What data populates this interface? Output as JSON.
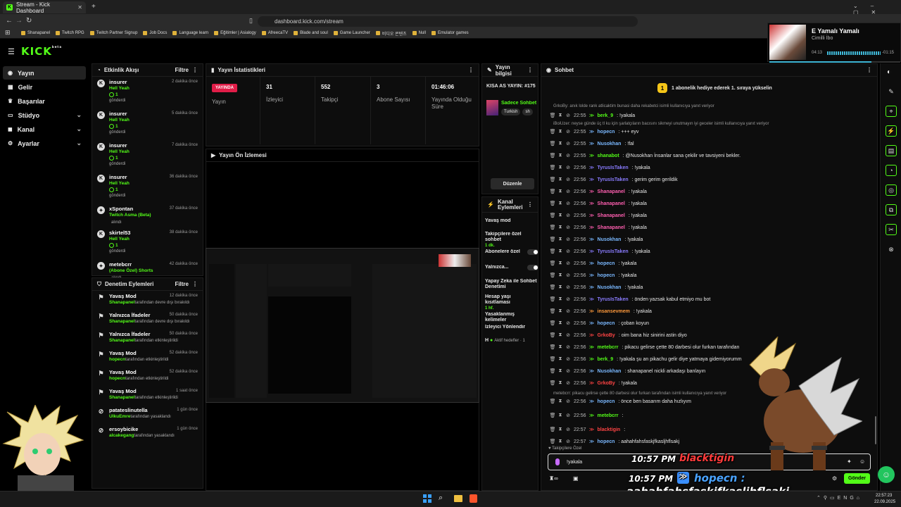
{
  "browser": {
    "tab_title": "Stream - Kick Dashboard",
    "url": "dashboard.kick.com/stream",
    "bookmarks": [
      "Shanapanel",
      "Twitch RPG",
      "Twitch Partner Signup",
      "Job Docs",
      "Language learn",
      "Eğitimler | Asialogy",
      "AfreecaTV",
      "Blade and soul",
      "Game Launcher",
      "비디오 콘텐츠",
      "Null",
      "Emulator games"
    ]
  },
  "music": {
    "title": "E Yamalı Yamalı",
    "artist": "Cimilli İbo",
    "elapsed": "04:13",
    "remaining": "-01:15"
  },
  "app": {
    "logo": "KICK",
    "logo_sup": "beta"
  },
  "nav": [
    {
      "label": "Yayın",
      "icon": "broadcast-icon",
      "active": true
    },
    {
      "label": "Gelir",
      "icon": "revenue-icon"
    },
    {
      "label": "Başarılar",
      "icon": "trophy-icon"
    },
    {
      "label": "Stüdyo",
      "icon": "studio-icon",
      "chev": true
    },
    {
      "label": "Kanal",
      "icon": "channel-icon",
      "chev": true
    },
    {
      "label": "Ayarlar",
      "icon": "settings-icon",
      "chev": true
    }
  ],
  "activity": {
    "title": "Etkinlik Akışı",
    "filter": "Filtre",
    "items": [
      {
        "name": "insurer",
        "sub": "Hell Yeah",
        "count": "1",
        "sent": "gönderdi",
        "time": "2 dakika önce"
      },
      {
        "name": "insurer",
        "sub": "Hell Yeah",
        "count": "1",
        "sent": "gönderdi",
        "time": "5 dakika önce"
      },
      {
        "name": "insurer",
        "sub": "Hell Yeah",
        "count": "1",
        "sent": "gönderdi",
        "time": "7 dakika önce"
      },
      {
        "name": "insurer",
        "sub": "Hell Yeah",
        "count": "1",
        "sent": "gönderdi",
        "time": "36 dakika önce"
      },
      {
        "name": "xSpontan",
        "sub": "Twitch Asma (Beta)",
        "sent": "alındı",
        "time": "37 dakika önce"
      },
      {
        "name": "skirtel53",
        "sub": "Hell Yeah",
        "count": "1",
        "sent": "gönderdi",
        "time": "38 dakika önce"
      },
      {
        "name": "metebcrr",
        "sub": "(Abone Özel) Shorts",
        "sent": "alındı",
        "time": "42 dakika önce"
      }
    ]
  },
  "moderation": {
    "title": "Denetim Eylemleri",
    "filter": "Filtre",
    "items": [
      {
        "name": "Yavaş Mod",
        "by": "Shanapanel",
        "rest": "tarafından devre dışı bırakıldı",
        "time": "12 dakika önce"
      },
      {
        "name": "Yalnızca İfadeler",
        "by": "Shanapanel",
        "rest": "tarafından devre dışı bırakıldı",
        "time": "50 dakika önce"
      },
      {
        "name": "Yalnızca İfadeler",
        "by": "Shanapanel",
        "rest": "tarafından etkinleştirildi",
        "time": "50 dakika önce"
      },
      {
        "name": "Yavaş Mod",
        "by": "hopecn",
        "rest": "tarafından etkinleştirildi",
        "time": "52 dakika önce"
      },
      {
        "name": "Yavaş Mod",
        "by": "hopecn",
        "rest": "tarafından etkinleştirildi",
        "time": "52 dakika önce"
      },
      {
        "name": "Yavaş Mod",
        "by": "Shanapanel",
        "rest": "tarafından etkinleştirildi",
        "time": "1 saat önce"
      },
      {
        "name": "patateslinutella",
        "by": "UlkuEmre",
        "rest": "tarafından yasaklandı",
        "time": "1 gün önce"
      },
      {
        "name": "ersoybicike",
        "by": "alcakegang",
        "rest": "tarafından yasaklandı",
        "time": "1 gün önce"
      }
    ]
  },
  "stats": {
    "title": "Yayın İstatistikleri",
    "live": "YAYINDA",
    "live_label": "Yayın",
    "viewers": "31",
    "viewers_label": "İzleyici",
    "followers": "552",
    "followers_label": "Takipçi",
    "subs": "3",
    "subs_label": "Abone Sayısı",
    "uptime": "01:46:06",
    "uptime_label": "Yayında Olduğu Süre"
  },
  "preview": {
    "title": "Yayın Ön İzlemesi"
  },
  "info": {
    "title": "Yayın bilgisi",
    "stream_title": "KISA AS YAYIN: #175",
    "category": "Sadece Sohbet",
    "tags": [
      "Turkish",
      "sh"
    ],
    "edit": "Düzenle"
  },
  "actions": {
    "title": "Kanal Eylemleri",
    "items": [
      "Yavaş mod",
      "Takipçilere özel sohbet",
      "Abonelere özel",
      "Yalnızca...",
      "Yapay Zeka ile Sohbet Denetimi",
      "Hesap yaşı kısıtlaması",
      "Yasaklanmış kelimeler",
      "İzleyici Yönlendir",
      "Aktif hedefler · 1"
    ],
    "follow_sub": "1 dk.",
    "age_sub": "1 hf.",
    "goal_prefix": "H"
  },
  "chat": {
    "title": "Sohbet",
    "gift_banner": "1 abonelik hediye ederek 1. sıraya yükselin",
    "replies": [
      {
        "text": "GrkoBy: anık lolde rank atlicaktim bunasi daha rekabetci isimli kullanıcıya yanıt veriyor"
      },
      {
        "text": "iBoiUzer: neyse günde üç tl ku için şarlatçıların bacısını sikmeyi unutmayın iyi geceler isimli kullanıcıya yanıt veriyor"
      },
      {
        "text": "metebcrr: pikacu gelirse çette 80 darbesi olur furkan tarafından isimli kullanıcıya yanıt veriyor"
      }
    ],
    "messages": [
      {
        "t": "22:55",
        "u": "berk_9",
        "c": "#53fc18",
        "m": ": !yakala"
      },
      {
        "t": "22:55",
        "u": "hopecn",
        "c": "#7ab8ff",
        "m": ": +++ eyv"
      },
      {
        "t": "22:55",
        "u": "Nusokhan",
        "c": "#7ab8ff",
        "m": ": !fal"
      },
      {
        "t": "22:55",
        "u": "shanabot",
        "c": "#53fc18",
        "m": ": @Nusokhan İnsanlar sana çekilir ve tavsiyeni bekler."
      },
      {
        "t": "22:56",
        "u": "TyrusIsTaken",
        "c": "#8a7cff",
        "m": ": !yakala"
      },
      {
        "t": "22:56",
        "u": "TyrusIsTaken",
        "c": "#8a7cff",
        "m": ": gerim gerim gerildik"
      },
      {
        "t": "22:56",
        "u": "Shanapanel",
        "c": "#ff5fb0",
        "m": ": !yakala"
      },
      {
        "t": "22:56",
        "u": "Shanapanel",
        "c": "#ff5fb0",
        "m": ": !yakala"
      },
      {
        "t": "22:56",
        "u": "Shanapanel",
        "c": "#ff5fb0",
        "m": ": !yakala"
      },
      {
        "t": "22:56",
        "u": "Shanapanel",
        "c": "#ff5fb0",
        "m": ": !yakala"
      },
      {
        "t": "22:56",
        "u": "Nusokhan",
        "c": "#7ab8ff",
        "m": ": !yakala"
      },
      {
        "t": "22:56",
        "u": "TyrusIsTaken",
        "c": "#8a7cff",
        "m": ": !yakala"
      },
      {
        "t": "22:56",
        "u": "hopecn",
        "c": "#7ab8ff",
        "m": ": !yakala"
      },
      {
        "t": "22:56",
        "u": "hopecn",
        "c": "#7ab8ff",
        "m": ": !yakala"
      },
      {
        "t": "22:56",
        "u": "Nusokhan",
        "c": "#7ab8ff",
        "m": ": !yakala"
      },
      {
        "t": "22:56",
        "u": "TyrusIsTaken",
        "c": "#8a7cff",
        "m": ": önden yazsak kabul etmiyo mu bot"
      },
      {
        "t": "22:56",
        "u": "insansevmem",
        "c": "#ff9a3c",
        "m": ": !yakala"
      },
      {
        "t": "22:56",
        "u": "hopecn",
        "c": "#7ab8ff",
        "m": ": çoban koyun"
      },
      {
        "t": "22:56",
        "u": "GrkoBy",
        "c": "#ff4444",
        "m": ": oim bana hiz sinirini astin diyo"
      },
      {
        "t": "22:56",
        "u": "metebcrr",
        "c": "#53fc18",
        "m": ": pikacu gelirse çette 80 darbesi olur furkan tarafından"
      },
      {
        "t": "22:56",
        "u": "berk_9",
        "c": "#53fc18",
        "m": ": !yakala şu an pikachu gelir diye yatmaya gidemiyorumm"
      },
      {
        "t": "22:56",
        "u": "Nusokhan",
        "c": "#7ab8ff",
        "m": ": shanapanel nickli arkadaşı banlayın"
      },
      {
        "t": "22:56",
        "u": "GrkoBy",
        "c": "#ff4444",
        "m": ": !yakala"
      },
      {
        "t": "22:56",
        "u": "hopecn",
        "c": "#7ab8ff",
        "m": ": önce ben basarım daha hızlıyım"
      },
      {
        "t": "22:56",
        "u": "metebcrr",
        "c": "#53fc18",
        "m": ": "
      },
      {
        "t": "22:57",
        "u": "blacktigin",
        "c": "#ff4444",
        "m": ": "
      },
      {
        "t": "22:57",
        "u": "hopecn",
        "c": "#7ab8ff",
        "m": ": aahahfahsfaskjfkasljhflsakj"
      }
    ],
    "follower_only": "Takipçilere Özel",
    "input_value": "!yakala",
    "send": "Gönder"
  },
  "overlays": {
    "time1": "10:57 PM",
    "user1": "blacktigin",
    "time2": "10:57 PM",
    "user2": "hopecn :",
    "msg2": "aahahfahsfaskjfkasljhflsakj"
  },
  "taskbar": {
    "time": "22:57:23",
    "date": "22.09.2025"
  }
}
